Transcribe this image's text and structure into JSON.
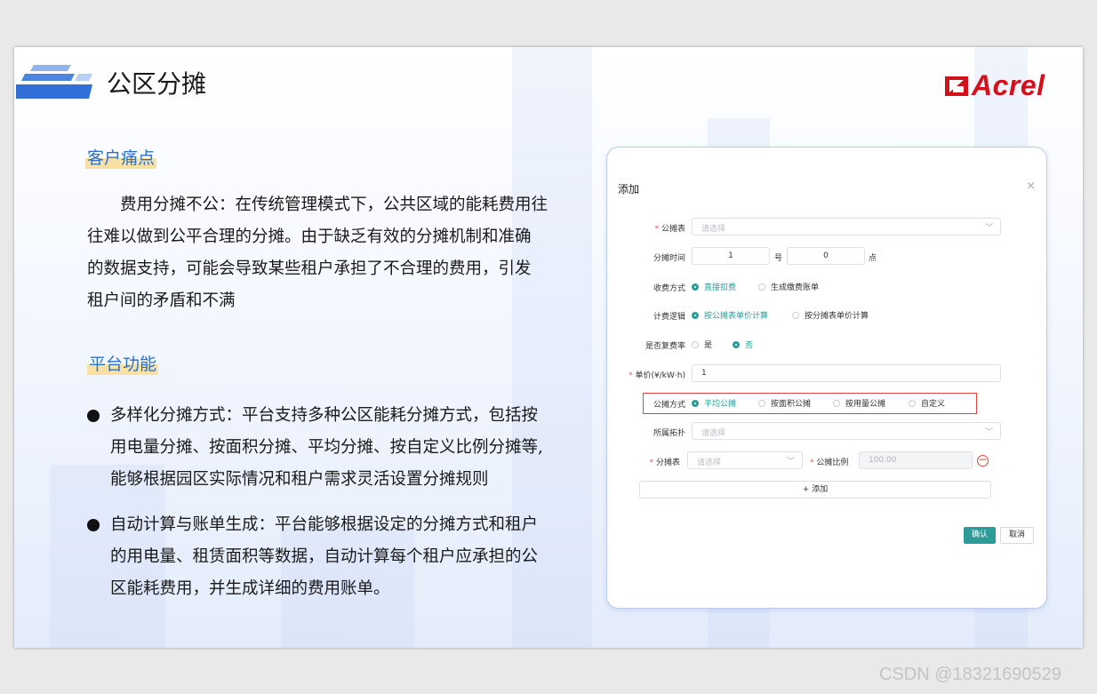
{
  "slide": {
    "title": "公区分摊",
    "brand": "Acrel",
    "section1": {
      "label": "客户痛点",
      "lines": [
        "　　费用分摊不公：在传统管理模式下，公共区域的能耗费用往",
        "往难以做到公平合理的分摊。由于缺乏有效的分摊机制和准确",
        "的数据支持，可能会导致某些租户承担了不合理的费用，引发",
        "租户间的矛盾和不满"
      ]
    },
    "section2": {
      "label": "平台功能",
      "bullets": [
        {
          "lines": [
            "多样化分摊方式：平台支持多种公区能耗分摊方式，包括按",
            "用电量分摊、按面积分摊、平均分摊、按自定义比例分摊等,",
            "能够根据园区实际情况和租户需求灵活设置分摊规则"
          ]
        },
        {
          "lines": [
            "自动计算与账单生成：平台能够根据设定的分摊方式和租户",
            "的用电量、租赁面积等数据，自动计算每个租户应承担的公",
            "区能耗费用，并生成详细的费用账单。"
          ]
        }
      ]
    }
  },
  "dialog": {
    "title": "添加",
    "close": "×",
    "field_gongtanbiao": {
      "label": "公摊表",
      "placeholder": "请选择"
    },
    "field_time": {
      "label": "分摊时间",
      "day": "1",
      "day_unit": "号",
      "hour": "0",
      "hour_unit": "点"
    },
    "field_charge": {
      "label": "收费方式",
      "options": [
        "直接扣费",
        "生成缴费账单"
      ],
      "selected": 0
    },
    "field_logic": {
      "label": "计费逻辑",
      "options": [
        "按公摊表单价计算",
        "按分摊表单价计算"
      ],
      "selected": 0
    },
    "field_rate": {
      "label": "是否复费率",
      "options": [
        "是",
        "否"
      ],
      "selected": 1
    },
    "field_price": {
      "label": "单价(¥/kW·h)",
      "value": "1"
    },
    "field_method": {
      "label": "公摊方式",
      "options": [
        "平均公摊",
        "按面积公摊",
        "按用量公摊",
        "自定义"
      ],
      "selected": 0
    },
    "field_topo": {
      "label": "所属拓扑",
      "placeholder": "请选择"
    },
    "field_fentanbiao": {
      "label": "分摊表",
      "placeholder": "请选择"
    },
    "field_ratio": {
      "label": "公摊比例",
      "placeholder": "100.00"
    },
    "add_label": "+ 添加",
    "ok_label": "确认",
    "cancel_label": "取消"
  },
  "watermark": "CSDN @18321690529",
  "colors": {
    "accent": "#2f9b98",
    "brand": "#d4101a",
    "section": "#2f6fc7",
    "highlight": "#e2463b"
  }
}
